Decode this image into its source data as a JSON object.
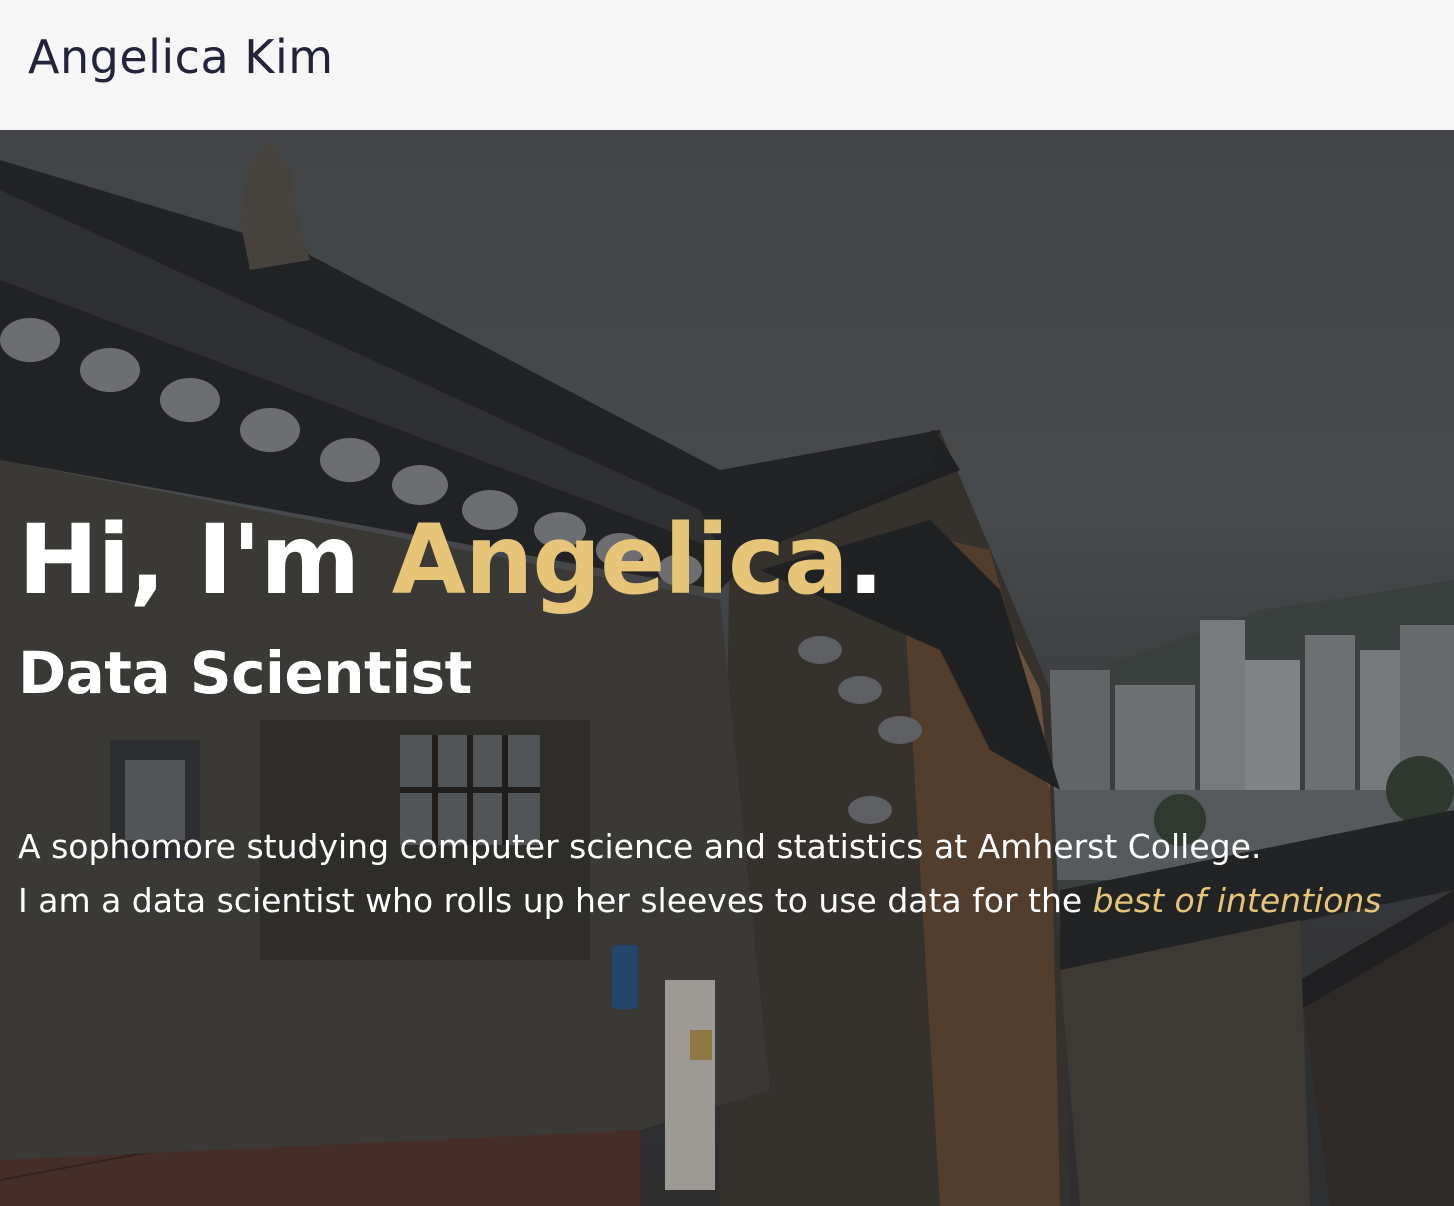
{
  "navbar": {
    "brand": "Angelica Kim"
  },
  "hero": {
    "greeting_prefix": "Hi, I'm ",
    "greeting_name": "Angelica",
    "greeting_suffix": ".",
    "role": "Data Scientist",
    "bio_line1": "A sophomore studying computer science and statistics at Amherst College.",
    "bio_line2_prefix": "I am a data scientist who rolls up her sleeves to use data for the ",
    "bio_line2_emphasis": "best of intentions"
  },
  "colors": {
    "accent": "#e6c578",
    "navbar_bg": "#f6f6f6",
    "brand_text": "#23243a"
  },
  "background_image": "hanok-village-rooftops-city-skyline"
}
